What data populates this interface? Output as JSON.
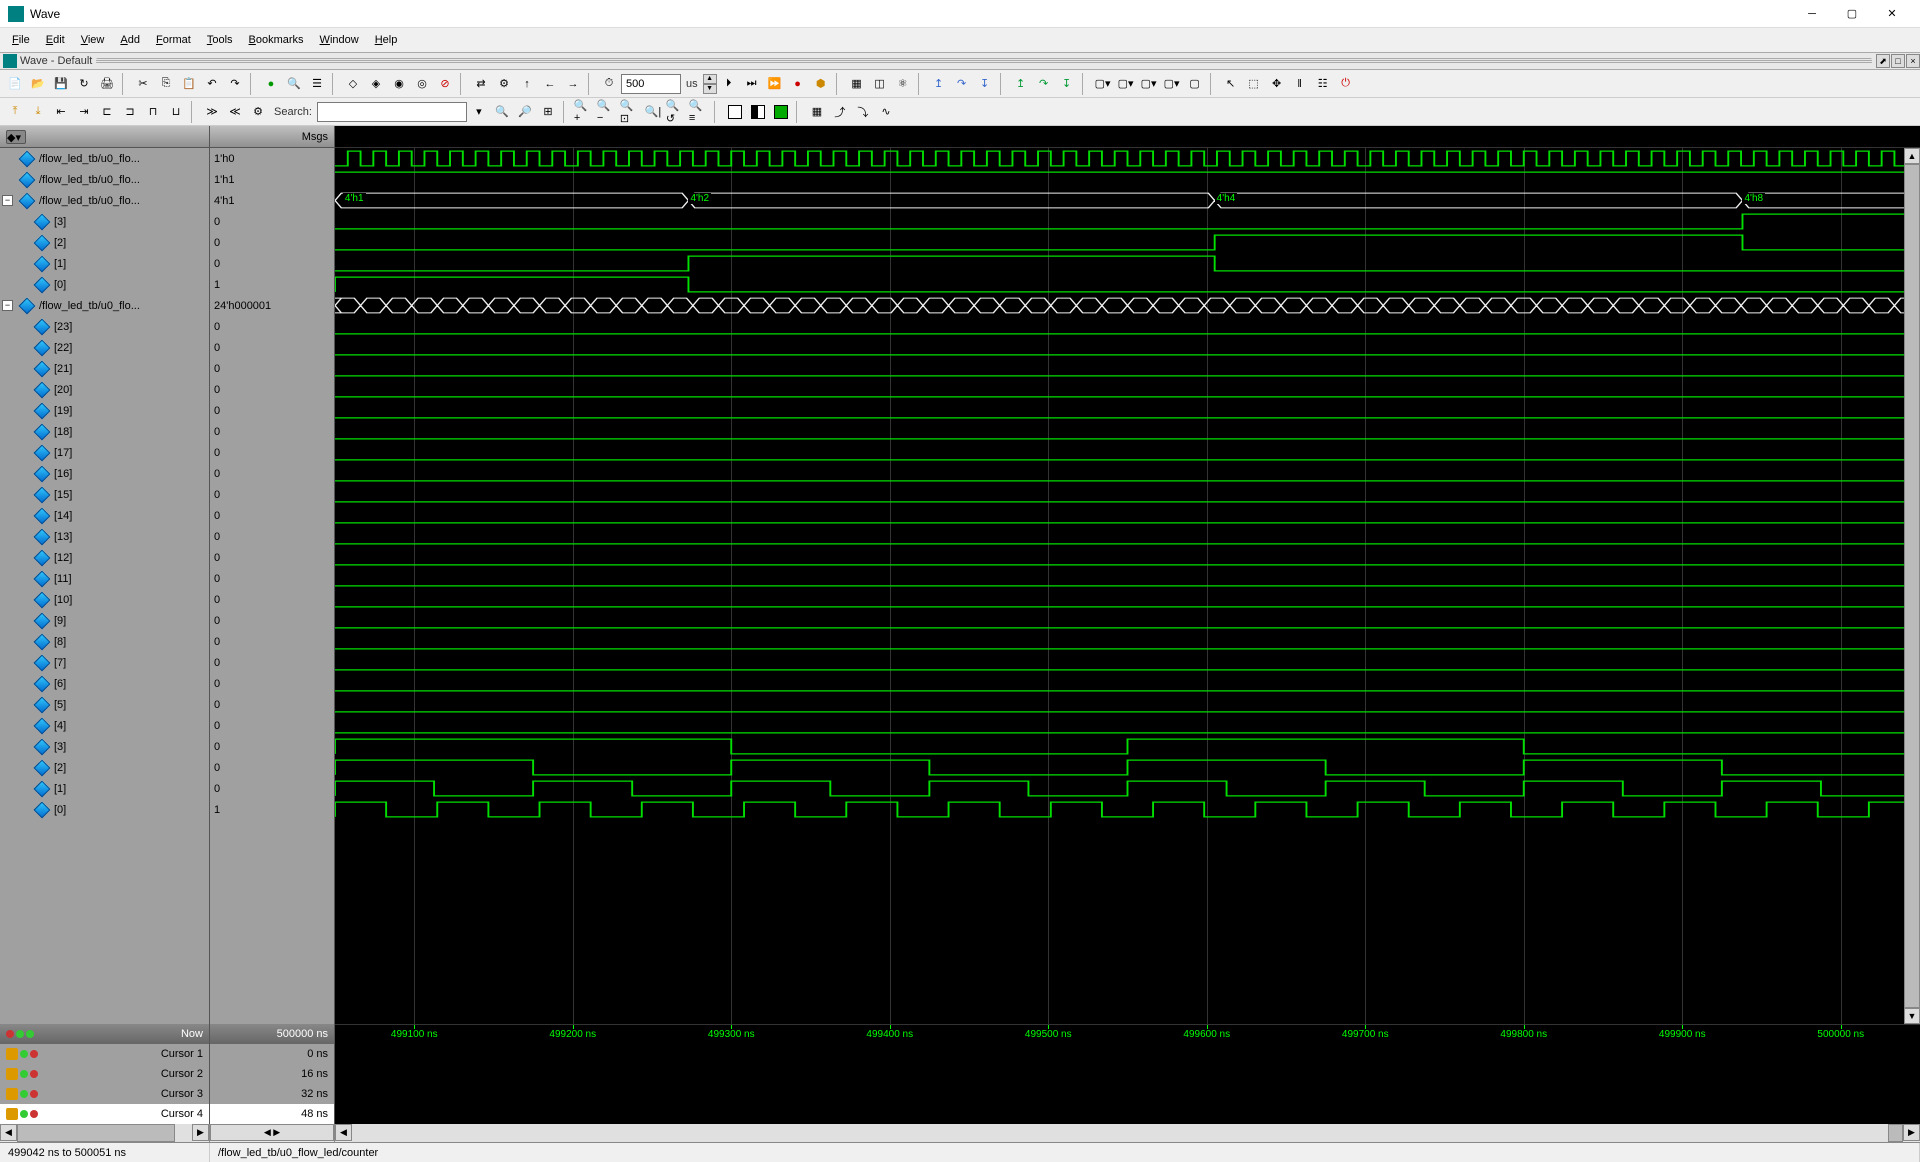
{
  "window": {
    "title": "Wave"
  },
  "menu": {
    "items": [
      "File",
      "Edit",
      "View",
      "Add",
      "Format",
      "Tools",
      "Bookmarks",
      "Window",
      "Help"
    ]
  },
  "subtitle": "Wave - Default",
  "toolbar": {
    "search_label": "Search:",
    "time_value": "500",
    "time_unit": "us"
  },
  "columns": {
    "msgs_header": "Msgs"
  },
  "signals": [
    {
      "name": "/flow_led_tb/u0_flo...",
      "value": "1'h0",
      "indent": 0,
      "expandable": false,
      "wave": "clock"
    },
    {
      "name": "/flow_led_tb/u0_flo...",
      "value": "1'h1",
      "indent": 0,
      "expandable": false,
      "wave": "high"
    },
    {
      "name": "/flow_led_tb/u0_flo...",
      "value": "4'h1",
      "indent": 0,
      "expandable": true,
      "expanded": true,
      "wave": "bus_led",
      "bus_labels": [
        {
          "x": 0.005,
          "t": "4'h1"
        },
        {
          "x": 0.223,
          "t": "4'h2"
        },
        {
          "x": 0.555,
          "t": "4'h4"
        },
        {
          "x": 0.888,
          "t": "4'h8"
        },
        {
          "x": 1.22,
          "t": "4'h1"
        }
      ]
    },
    {
      "name": "[3]",
      "value": "0",
      "indent": 2,
      "wave": "bit3"
    },
    {
      "name": "[2]",
      "value": "0",
      "indent": 2,
      "wave": "bit2"
    },
    {
      "name": "[1]",
      "value": "0",
      "indent": 2,
      "wave": "bit1"
    },
    {
      "name": "[0]",
      "value": "1",
      "indent": 2,
      "wave": "bit0"
    },
    {
      "name": "/flow_led_tb/u0_flo...",
      "value": "24'h000001",
      "indent": 0,
      "expandable": true,
      "expanded": true,
      "wave": "bus_ctr"
    },
    {
      "name": "[23]",
      "value": "0",
      "indent": 2,
      "wave": "low"
    },
    {
      "name": "[22]",
      "value": "0",
      "indent": 2,
      "wave": "low"
    },
    {
      "name": "[21]",
      "value": "0",
      "indent": 2,
      "wave": "low"
    },
    {
      "name": "[20]",
      "value": "0",
      "indent": 2,
      "wave": "low"
    },
    {
      "name": "[19]",
      "value": "0",
      "indent": 2,
      "wave": "low"
    },
    {
      "name": "[18]",
      "value": "0",
      "indent": 2,
      "wave": "low"
    },
    {
      "name": "[17]",
      "value": "0",
      "indent": 2,
      "wave": "low"
    },
    {
      "name": "[16]",
      "value": "0",
      "indent": 2,
      "wave": "low"
    },
    {
      "name": "[15]",
      "value": "0",
      "indent": 2,
      "wave": "low"
    },
    {
      "name": "[14]",
      "value": "0",
      "indent": 2,
      "wave": "low"
    },
    {
      "name": "[13]",
      "value": "0",
      "indent": 2,
      "wave": "low"
    },
    {
      "name": "[12]",
      "value": "0",
      "indent": 2,
      "wave": "low"
    },
    {
      "name": "[11]",
      "value": "0",
      "indent": 2,
      "wave": "low"
    },
    {
      "name": "[10]",
      "value": "0",
      "indent": 2,
      "wave": "low"
    },
    {
      "name": "[9]",
      "value": "0",
      "indent": 2,
      "wave": "low"
    },
    {
      "name": "[8]",
      "value": "0",
      "indent": 2,
      "wave": "low"
    },
    {
      "name": "[7]",
      "value": "0",
      "indent": 2,
      "wave": "low"
    },
    {
      "name": "[6]",
      "value": "0",
      "indent": 2,
      "wave": "low"
    },
    {
      "name": "[5]",
      "value": "0",
      "indent": 2,
      "wave": "low"
    },
    {
      "name": "[4]",
      "value": "0",
      "indent": 2,
      "wave": "low"
    },
    {
      "name": "[3]",
      "value": "0",
      "indent": 2,
      "wave": "ctr3"
    },
    {
      "name": "[2]",
      "value": "0",
      "indent": 2,
      "wave": "ctr2"
    },
    {
      "name": "[1]",
      "value": "0",
      "indent": 2,
      "wave": "ctr1"
    },
    {
      "name": "[0]",
      "value": "1",
      "indent": 2,
      "wave": "ctr0"
    }
  ],
  "time_axis": {
    "ticks": [
      "499100 ns",
      "499200 ns",
      "499300 ns",
      "499400 ns",
      "499500 ns",
      "499600 ns",
      "499700 ns",
      "499800 ns",
      "499900 ns",
      "500000 ns"
    ]
  },
  "cursors": {
    "now_label": "Now",
    "now_value": "500000 ns",
    "rows": [
      {
        "label": "Cursor 1",
        "value": "0 ns"
      },
      {
        "label": "Cursor 2",
        "value": "16 ns"
      },
      {
        "label": "Cursor 3",
        "value": "32 ns"
      },
      {
        "label": "Cursor 4",
        "value": "48 ns",
        "selected": true
      }
    ]
  },
  "status": {
    "range": "499042 ns to 500051 ns",
    "path": "/flow_led_tb/u0_flow_led/counter"
  },
  "colors": {
    "wave_green": "#00e000",
    "wave_white": "#f0f0f0"
  }
}
